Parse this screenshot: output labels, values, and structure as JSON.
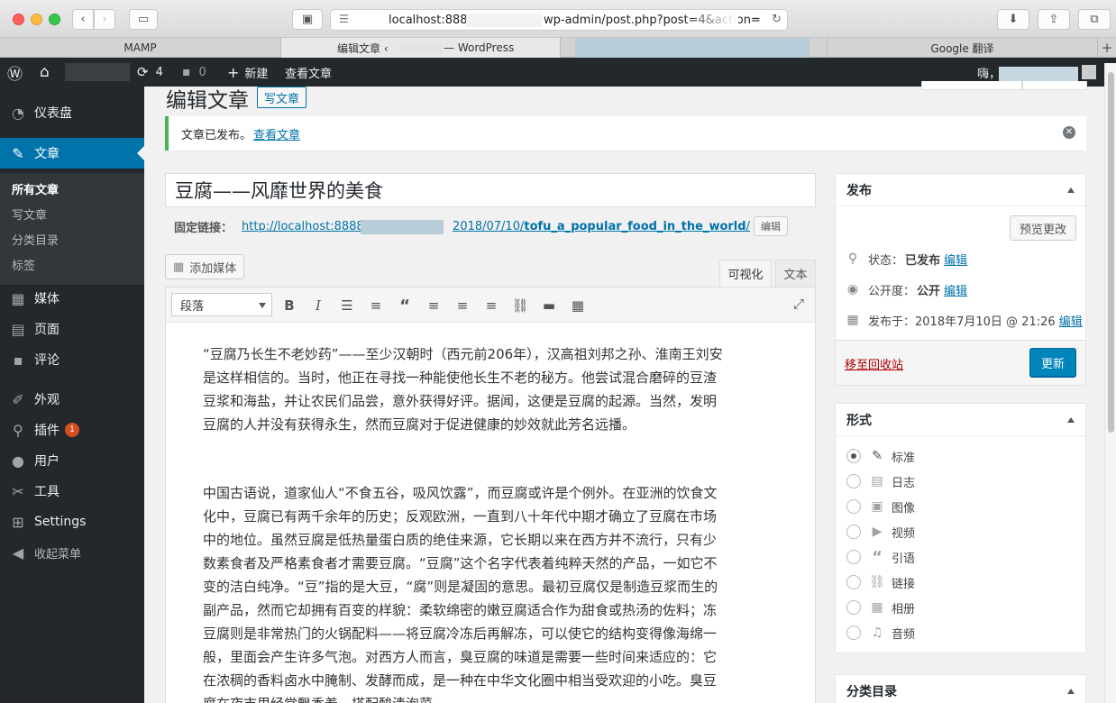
{
  "browser": {
    "url_left": "localhost:8888/",
    "url_right": "wp-admin/post.php?post=4&action=",
    "tabs": [
      "MAMP",
      "编辑文章 ‹",
      "— WordPress",
      "Google 翻译"
    ]
  },
  "adminbar": {
    "updates_count": "4",
    "comments_count": "0",
    "new_label": "新建",
    "view_post_label": "查看文章",
    "greeting": "嗨，"
  },
  "sidebar": {
    "dashboard": "仪表盘",
    "posts": "文章",
    "submenu": [
      "所有文章",
      "写文章",
      "分类目录",
      "标签"
    ],
    "media": "媒体",
    "pages": "页面",
    "comments": "评论",
    "appearance": "外观",
    "plugins": "插件",
    "plugins_badge": "1",
    "users": "用户",
    "tools": "工具",
    "settings": "Settings",
    "collapse": "收起菜单"
  },
  "page": {
    "title": "编辑文章",
    "add_new": "写文章",
    "notice_text": "文章已发布。",
    "notice_link": "查看文章",
    "post_title": "豆腐——风靡世界的美食",
    "permalink_label": "固定链接：",
    "permalink_start": "http://localhost:8888/",
    "permalink_end": "2018/07/10/",
    "permalink_slug": "tofu_a_popular_food_in_the_world",
    "permalink_trail": "/",
    "permalink_edit": "编辑",
    "add_media": "添加媒体",
    "tab_visual": "可视化",
    "tab_text": "文本",
    "format_value": "段落"
  },
  "content": {
    "paragraphs": [
      "“豆腐乃长生不老妙药”——至少汉朝时（西元前206年），汉高祖刘邦之孙、淮南王刘安是这样相信的。当时，他正在寻找一种能使他长生不老的秘方。他尝试混合磨碎的豆渣豆浆和海盐，并让农民们品尝，意外获得好评。据闻，这便是豆腐的起源。当然，发明豆腐的人并没有获得永生，然而豆腐对于促进健康的妙效就此芳名远播。",
      "中国古语说，道家仙人“不食五谷，吸风饮露”，而豆腐或许是个例外。在亚洲的饮食文化中，豆腐已有两千余年的历史；反观欧洲，一直到八十年代中期才确立了豆腐在市场中的地位。虽然豆腐是低热量蛋白质的绝佳来源，它长期以来在西方并不流行，只有少数素食者及严格素食者才需要豆腐。“豆腐”这个名字代表着纯粹天然的产品，一如它不变的洁白纯净。“豆”指的是大豆，“腐”则是凝固的意思。最初豆腐仅是制造豆浆而生的副产品，然而它却拥有百变的样貌：柔软绵密的嫩豆腐适合作为甜食或热汤的佐料；冻豆腐则是非常热门的火锅配料——将豆腐冷冻后再解冻，可以使它的结构变得像海绵一般，里面会产生许多气泡。对西方人而言，臭豆腐的味道是需要一些时间来适应的：它在浓稠的香料卤水中腌制、发酵而成，是一种在中华文化圈中相当受欢迎的小吃。臭豆腐在夜市里经常飘香着，搭配酸渍泡菜"
    ]
  },
  "publish": {
    "title": "发布",
    "preview": "预览更改",
    "status_label": "状态：",
    "status_value": "已发布",
    "visibility_label": "公开度：",
    "visibility_value": "公开",
    "published_label": "发布于：",
    "published_value": "2018年7月10日 @ 21:26",
    "edit": "编辑",
    "trash": "移至回收站",
    "update": "更新"
  },
  "formats": {
    "title": "形式",
    "items": [
      "标准",
      "日志",
      "图像",
      "视频",
      "引语",
      "链接",
      "相册",
      "音频"
    ]
  },
  "categories": {
    "title": "分类目录"
  }
}
